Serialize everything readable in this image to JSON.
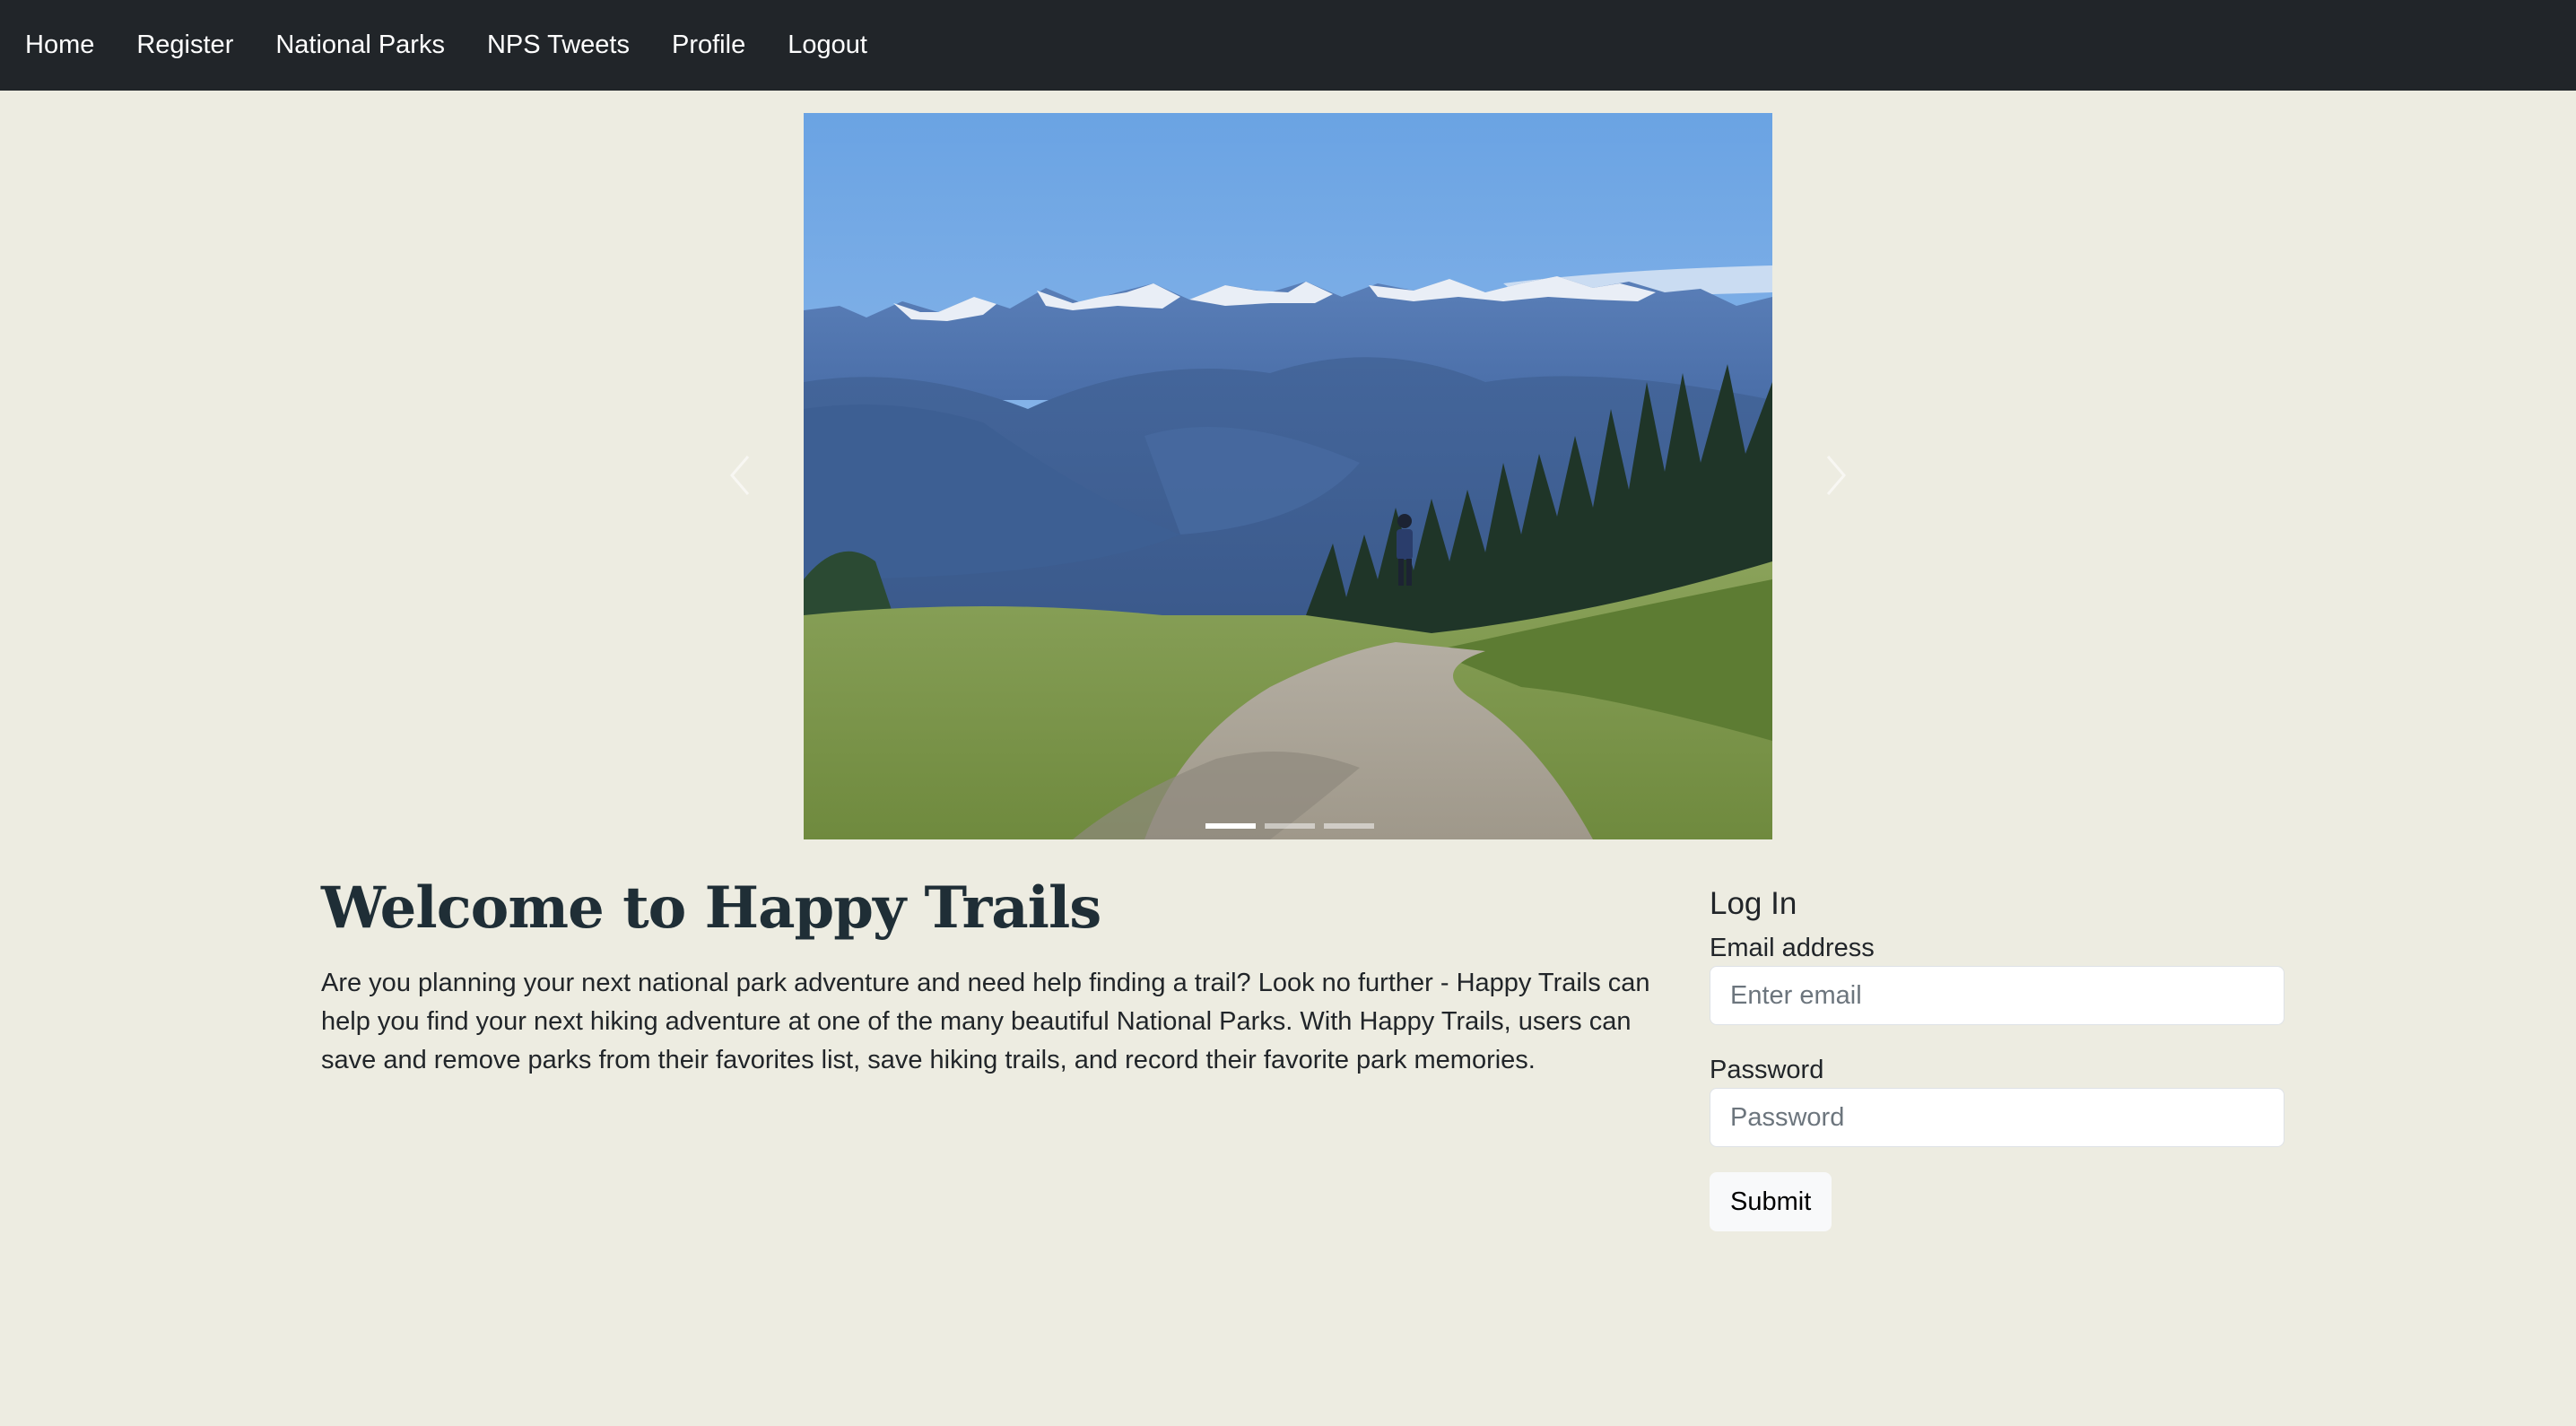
{
  "nav": {
    "items": [
      {
        "label": "Home"
      },
      {
        "label": "Register"
      },
      {
        "label": "National Parks"
      },
      {
        "label": "NPS Tweets"
      },
      {
        "label": "Profile"
      },
      {
        "label": "Logout"
      }
    ]
  },
  "carousel": {
    "slide_count": 3,
    "active_index": 0,
    "prev_icon": "chevron-left-icon",
    "next_icon": "chevron-right-icon"
  },
  "welcome": {
    "title": "Welcome to Happy Trails",
    "text": "Are you planning your next national park adventure and need help finding a trail? Look no further - Happy Trails can help you find your next hiking adventure at one of the many beautiful National Parks. With Happy Trails, users can save and remove parks from their favorites list, save hiking trails, and record their favorite park memories."
  },
  "login": {
    "title": "Log In",
    "email_label": "Email address",
    "email_placeholder": "Enter email",
    "password_label": "Password",
    "password_placeholder": "Password",
    "submit_label": "Submit"
  },
  "colors": {
    "navbar_bg": "#212529",
    "page_bg": "#edece1",
    "heading": "#1f2e36"
  }
}
